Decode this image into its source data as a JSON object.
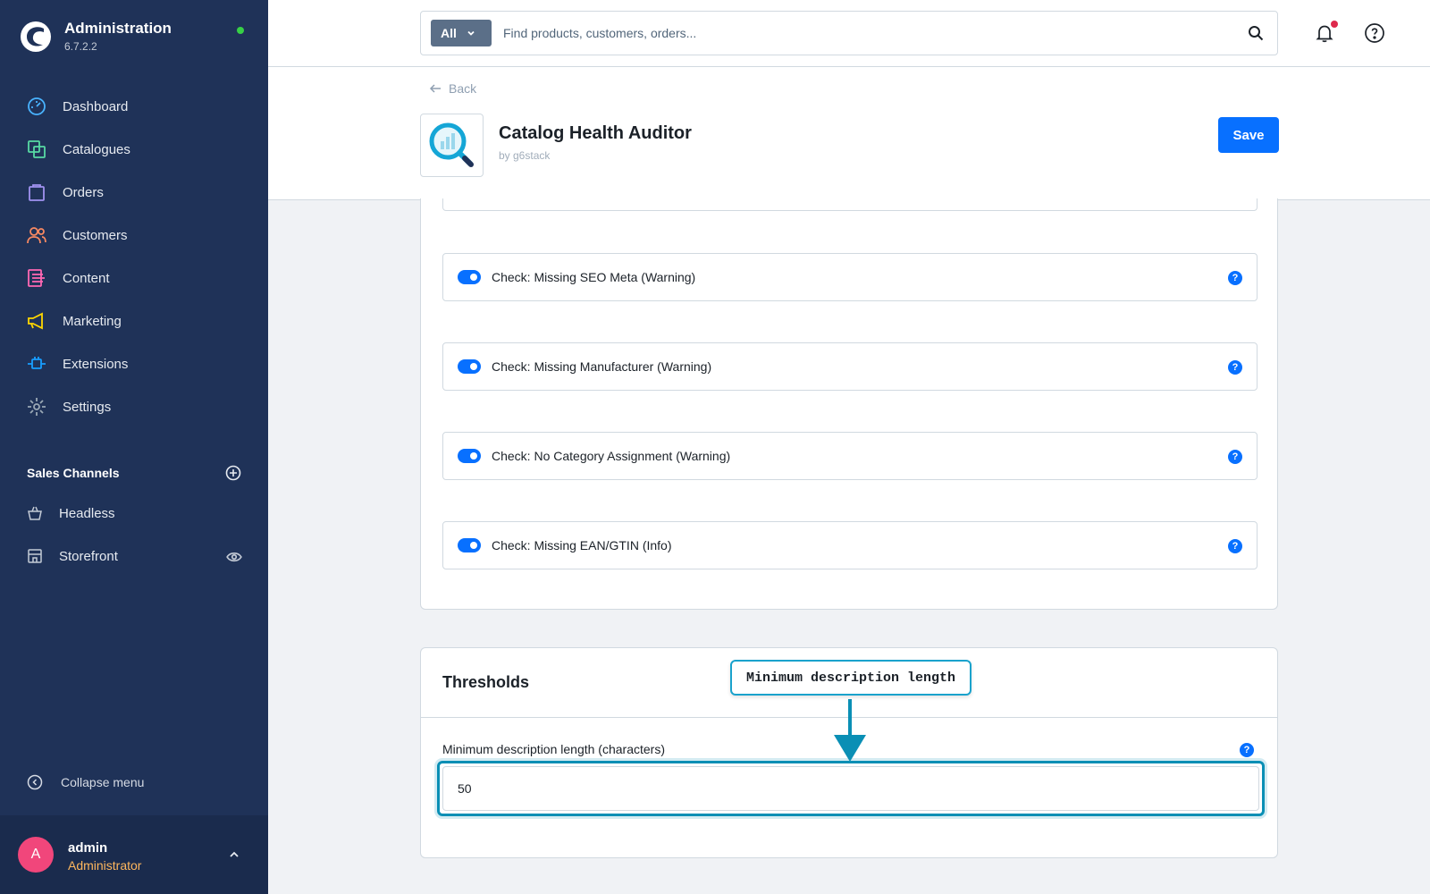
{
  "sidebar": {
    "brand_title": "Administration",
    "brand_version": "6.7.2.2",
    "nav": [
      {
        "label": "Dashboard",
        "icon": "dashboard-icon",
        "color": "#49b3ff"
      },
      {
        "label": "Catalogues",
        "icon": "catalogue-icon",
        "color": "#57d9a3"
      },
      {
        "label": "Orders",
        "icon": "orders-icon",
        "color": "#a092f0"
      },
      {
        "label": "Customers",
        "icon": "customers-icon",
        "color": "#f88962"
      },
      {
        "label": "Content",
        "icon": "content-icon",
        "color": "#ff68b4"
      },
      {
        "label": "Marketing",
        "icon": "marketing-icon",
        "color": "#ffd700"
      },
      {
        "label": "Extensions",
        "icon": "extensions-icon",
        "color": "#189eff"
      },
      {
        "label": "Settings",
        "icon": "settings-icon",
        "color": "#9aa8b5"
      }
    ],
    "sales_channels_title": "Sales Channels",
    "sales_channels": [
      {
        "label": "Headless",
        "icon": "basket-icon"
      },
      {
        "label": "Storefront",
        "icon": "storefront-icon"
      }
    ],
    "collapse_label": "Collapse menu",
    "user": {
      "initial": "A",
      "name": "admin",
      "role": "Administrator"
    }
  },
  "topbar": {
    "search_type": "All",
    "search_placeholder": "Find products, customers, orders..."
  },
  "smartbar": {
    "back_label": "Back",
    "app_title": "Catalog Health Auditor",
    "app_by": "by g6stack",
    "save_label": "Save"
  },
  "checks": [
    {
      "label": "Check: Missing SEO Meta (Warning)",
      "enabled": true
    },
    {
      "label": "Check: Missing Manufacturer (Warning)",
      "enabled": true
    },
    {
      "label": "Check: No Category Assignment (Warning)",
      "enabled": true
    },
    {
      "label": "Check: Missing EAN/GTIN (Info)",
      "enabled": true
    }
  ],
  "thresholds": {
    "title": "Thresholds",
    "field_label": "Minimum description length (characters)",
    "field_value": "50"
  },
  "annotation": {
    "callout_text": "Minimum description length",
    "color": "#1aa2cc"
  },
  "colors": {
    "sidebar_bg": "#1f3258",
    "primary": "#0870ff"
  }
}
